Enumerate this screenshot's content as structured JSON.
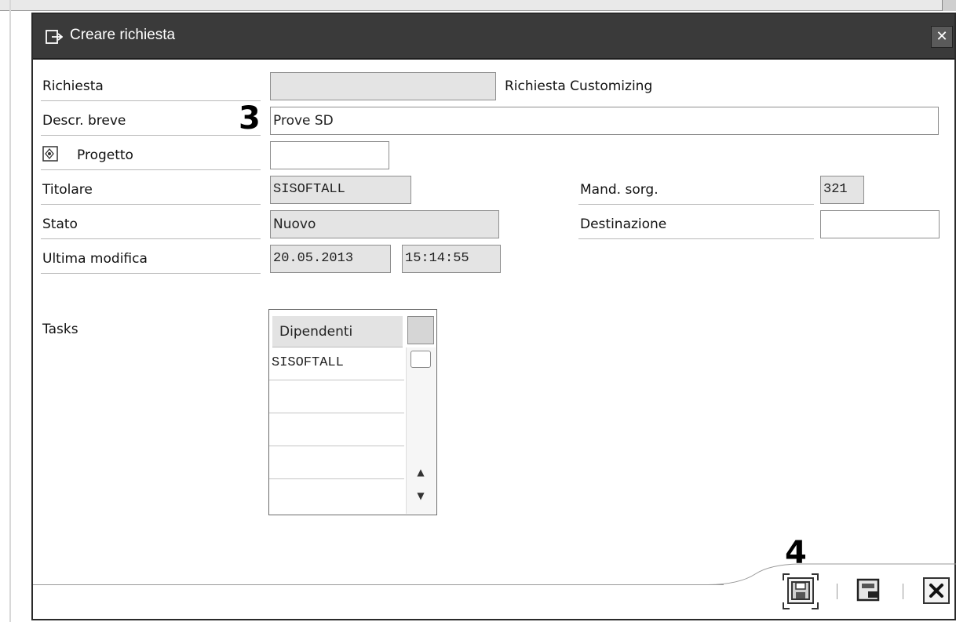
{
  "dialog": {
    "title": "Creare richiesta",
    "title_icon": "create-request-icon",
    "close_icon": "close-icon"
  },
  "form": {
    "richiesta": {
      "label": "Richiesta",
      "value": "",
      "type_text": "Richiesta Customizing"
    },
    "descr_breve": {
      "label": "Descr. breve",
      "value": "Prove SD"
    },
    "progetto": {
      "label": "Progetto",
      "value": "",
      "icon": "project-icon"
    },
    "titolare": {
      "label": "Titolare",
      "value": "SISOFTALL"
    },
    "stato": {
      "label": "Stato",
      "value": "Nuovo"
    },
    "ultima_modifica": {
      "label": "Ultima modifica",
      "date": "20.05.2013",
      "time": "15:14:55"
    },
    "mand_sorg": {
      "label": "Mand. sorg.",
      "value": "321"
    },
    "destinazione": {
      "label": "Destinazione",
      "value": ""
    }
  },
  "tasks": {
    "label": "Tasks",
    "column_header": "Dipendenti",
    "rows": [
      "SISOFTALL",
      "",
      "",
      "",
      ""
    ]
  },
  "toolbar": {
    "save_icon": "save-icon",
    "save_local_icon": "save-local-icon",
    "cancel_icon": "cancel-icon"
  },
  "annotations": {
    "marker_3": "3",
    "marker_4": "4"
  }
}
